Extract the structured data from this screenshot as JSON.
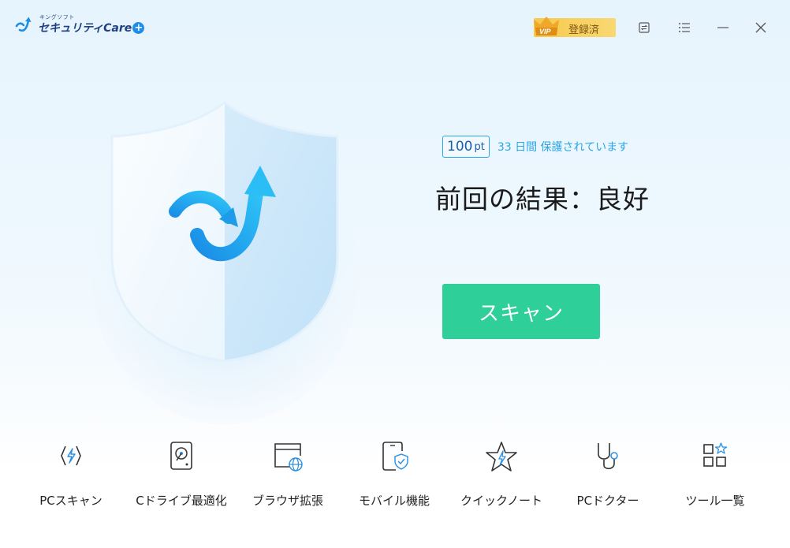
{
  "app": {
    "logo_small": "キングソフト",
    "logo_main": "セキュリティCare",
    "logo_plus": "+"
  },
  "titlebar": {
    "vip_label": "登録済",
    "vip_crown_text": "VIP",
    "buttons": [
      "feedback-icon",
      "menu-icon",
      "minimize-icon",
      "close-icon"
    ]
  },
  "status": {
    "points_value": "100",
    "points_unit": "pt",
    "protection_text": "33 日間 保護されています",
    "result_text": "前回の結果：良好"
  },
  "scan": {
    "label": "スキャン"
  },
  "tools": [
    {
      "label": "PCスキャン",
      "icon": "lightning-hexagon-icon"
    },
    {
      "label": "Cドライブ最適化",
      "icon": "disk-icon"
    },
    {
      "label": "ブラウザ拡張",
      "icon": "browser-globe-icon"
    },
    {
      "label": "モバイル機能",
      "icon": "phone-shield-icon"
    },
    {
      "label": "クイックノート",
      "icon": "star-note-icon"
    },
    {
      "label": "PCドクター",
      "icon": "stethoscope-icon"
    },
    {
      "label": "ツール一覧",
      "icon": "grid-star-icon"
    }
  ],
  "colors": {
    "accent": "#2ecf99",
    "brand_blue": "#2aa6e8",
    "vip_gold": "#f7c94c"
  }
}
